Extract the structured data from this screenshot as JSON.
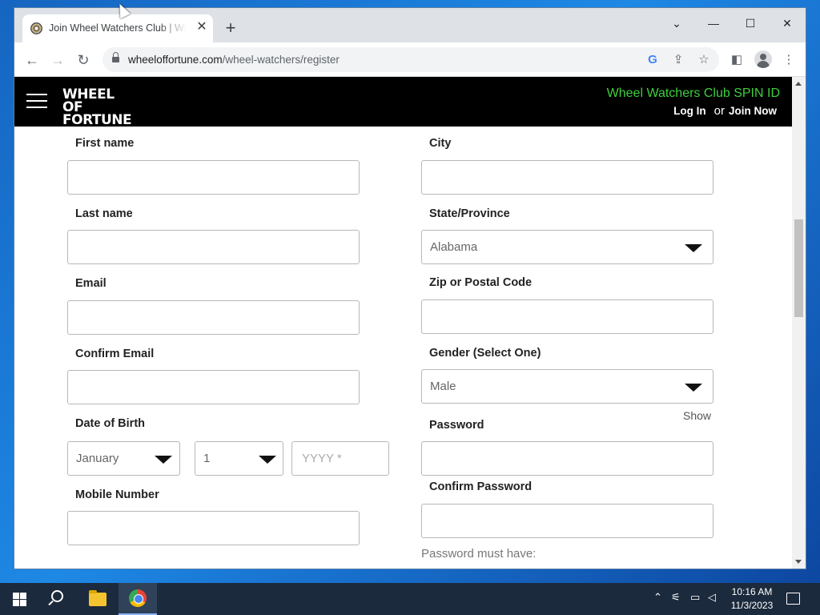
{
  "browser": {
    "tab_title": "Join Wheel Watchers Club | Wheel of Fortune",
    "tab_close": "✕",
    "new_tab": "+",
    "url_domain": "wheeloffortune.com",
    "url_path": "/wheel-watchers/register",
    "window_controls": {
      "dropdown": "⌄",
      "minimize": "—",
      "maximize": "☐",
      "close": "✕"
    }
  },
  "site": {
    "logo_line1": "WHEEL OF",
    "logo_line2": "FORTUNE",
    "spin_id_link": "Wheel Watchers Club SPIN ID",
    "login": "Log In",
    "or": "or",
    "join": "Join Now",
    "accent_color": "#3ecf3e"
  },
  "form": {
    "first_name": "First name",
    "last_name": "Last name",
    "email": "Email",
    "confirm_email": "Confirm Email",
    "dob": "Date of Birth",
    "dob_month": "January",
    "dob_day": "1",
    "dob_year_placeholder": "YYYY *",
    "mobile": "Mobile Number",
    "city": "City",
    "state": "State/Province",
    "state_value": "Alabama",
    "zip": "Zip or Postal Code",
    "gender": "Gender (Select One)",
    "gender_value": "Male",
    "show": "Show",
    "password": "Password",
    "confirm_password": "Confirm Password",
    "password_note": "Password must have:"
  },
  "taskbar": {
    "time": "10:16 AM",
    "date": "11/3/2023"
  }
}
